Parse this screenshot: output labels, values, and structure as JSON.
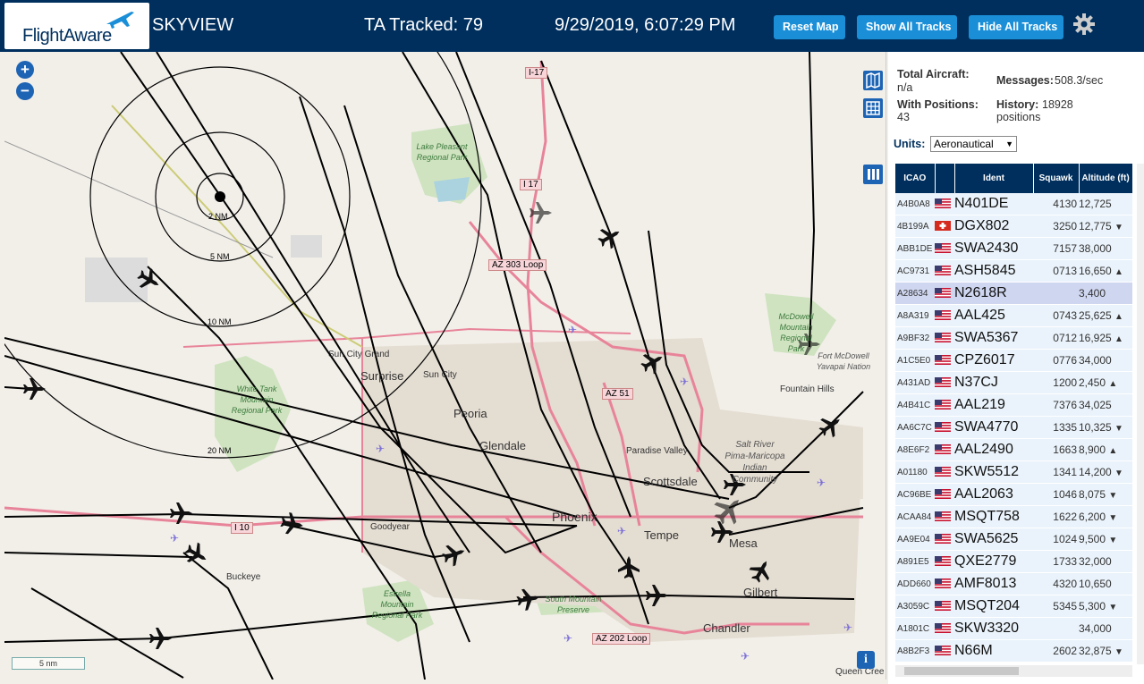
{
  "header": {
    "logo_text": "FlightAware",
    "app_title": "SKYVIEW",
    "tracked_label": "TA Tracked: 79",
    "clock": "9/29/2019, 6:07:29 PM",
    "buttons": {
      "reset": "Reset Map",
      "show": "Show All Tracks",
      "hide": "Hide All Tracks"
    },
    "settings_icon": "gear-icon"
  },
  "map": {
    "zoom_in": "+",
    "zoom_out": "−",
    "range_rings": [
      "2 NM",
      "5 NM",
      "10 NM",
      "20 NM"
    ],
    "scale": "5 nm",
    "info": "i",
    "labels": {
      "roads": [
        "I-17",
        "I 17",
        "AZ 303 Loop",
        "AZ 51",
        "I 10",
        "AZ 202 Loop"
      ],
      "places": [
        "Lake Pleasant Regional Park",
        "Sun City Grand",
        "Surprise",
        "Sun City",
        "White Tank Mountain Regional Park",
        "Peoria",
        "Glendale",
        "Paradise Valley",
        "Scottsdale",
        "Salt River Pima-Maricopa Indian Community",
        "Phoenix",
        "Tempe",
        "Mesa",
        "Goodyear",
        "Buckeye",
        "Estrella Mountain Regional Park",
        "South Mountain Preserve",
        "Gilbert",
        "Chandler",
        "McDowell Mountain Regional Park",
        "Fort McDowell Yavapai Nation",
        "Fountain Hills",
        "Queen Cree"
      ]
    }
  },
  "sidebar": {
    "stats": {
      "total_label": "Total Aircraft:",
      "total_value": "n/a",
      "messages_label": "Messages:",
      "messages_value": "508.3/sec",
      "positions_label": "With Positions:",
      "positions_value": "43",
      "history_label": "History:",
      "history_value_1": "18928",
      "history_value_2": "positions"
    },
    "units_label": "Units:",
    "units_value": "Aeronautical",
    "columns": [
      "ICAO",
      "",
      "Ident",
      "Squawk",
      "Altitude (ft)"
    ],
    "rows": [
      {
        "icao": "A4B0A8",
        "flag": "us",
        "ident": "N401DE",
        "squawk": "4130",
        "alt": "12,725",
        "trend": ""
      },
      {
        "icao": "4B199A",
        "flag": "ch",
        "ident": "DGX802",
        "squawk": "3250",
        "alt": "12,775",
        "trend": "▼"
      },
      {
        "icao": "ABB1DE",
        "flag": "us",
        "ident": "SWA2430",
        "squawk": "7157",
        "alt": "38,000",
        "trend": ""
      },
      {
        "icao": "AC9731",
        "flag": "us",
        "ident": "ASH5845",
        "squawk": "0713",
        "alt": "16,650",
        "trend": "▲"
      },
      {
        "icao": "A28634",
        "flag": "us",
        "ident": "N2618R",
        "squawk": "",
        "alt": "3,400",
        "trend": ""
      },
      {
        "icao": "A8A319",
        "flag": "us",
        "ident": "AAL425",
        "squawk": "0743",
        "alt": "25,625",
        "trend": "▲"
      },
      {
        "icao": "A9BF32",
        "flag": "us",
        "ident": "SWA5367",
        "squawk": "0712",
        "alt": "16,925",
        "trend": "▲"
      },
      {
        "icao": "A1C5E0",
        "flag": "us",
        "ident": "CPZ6017",
        "squawk": "0776",
        "alt": "34,000",
        "trend": ""
      },
      {
        "icao": "A431AD",
        "flag": "us",
        "ident": "N37CJ",
        "squawk": "1200",
        "alt": "2,450",
        "trend": "▲"
      },
      {
        "icao": "A4B41C",
        "flag": "us",
        "ident": "AAL219",
        "squawk": "7376",
        "alt": "34,025",
        "trend": ""
      },
      {
        "icao": "AA6C7C",
        "flag": "us",
        "ident": "SWA4770",
        "squawk": "1335",
        "alt": "10,325",
        "trend": "▼"
      },
      {
        "icao": "A8E6F2",
        "flag": "us",
        "ident": "AAL2490",
        "squawk": "1663",
        "alt": "8,900",
        "trend": "▲"
      },
      {
        "icao": "A01180",
        "flag": "us",
        "ident": "SKW5512",
        "squawk": "1341",
        "alt": "14,200",
        "trend": "▼"
      },
      {
        "icao": "AC96BE",
        "flag": "us",
        "ident": "AAL2063",
        "squawk": "1046",
        "alt": "8,075",
        "trend": "▼"
      },
      {
        "icao": "ACAA84",
        "flag": "us",
        "ident": "MSQT758",
        "squawk": "1622",
        "alt": "6,200",
        "trend": "▼"
      },
      {
        "icao": "AA9E04",
        "flag": "us",
        "ident": "SWA5625",
        "squawk": "1024",
        "alt": "9,500",
        "trend": "▼"
      },
      {
        "icao": "A891E5",
        "flag": "us",
        "ident": "QXE2779",
        "squawk": "1733",
        "alt": "32,000",
        "trend": ""
      },
      {
        "icao": "ADD660",
        "flag": "us",
        "ident": "AMF8013",
        "squawk": "4320",
        "alt": "10,650",
        "trend": ""
      },
      {
        "icao": "A3059C",
        "flag": "us",
        "ident": "MSQT204",
        "squawk": "5345",
        "alt": "5,300",
        "trend": "▼"
      },
      {
        "icao": "A1801C",
        "flag": "us",
        "ident": "SKW3320",
        "squawk": "",
        "alt": "34,000",
        "trend": ""
      },
      {
        "icao": "A8B2F3",
        "flag": "us",
        "ident": "N66M",
        "squawk": "2602",
        "alt": "32,875",
        "trend": "▼"
      }
    ],
    "selected_icao": "A28634"
  }
}
